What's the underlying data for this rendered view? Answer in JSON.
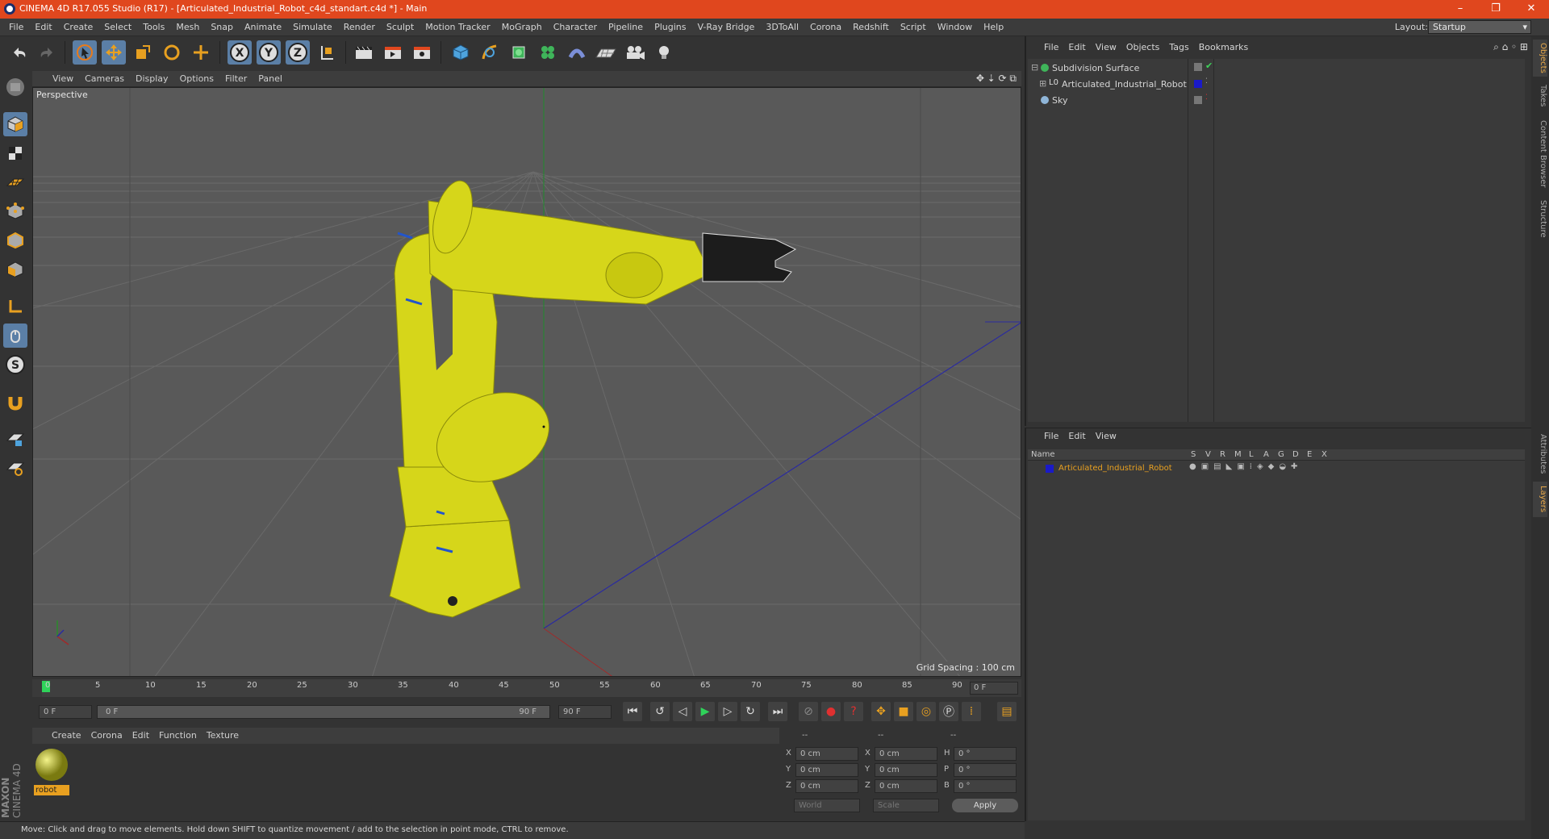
{
  "window": {
    "title": "CINEMA 4D R17.055 Studio (R17) - [Articulated_Industrial_Robot_c4d_standart.c4d *] - Main",
    "minimize": "–",
    "maximize": "❐",
    "close": "✕"
  },
  "menubar": {
    "items": [
      "File",
      "Edit",
      "Create",
      "Select",
      "Tools",
      "Mesh",
      "Snap",
      "Animate",
      "Simulate",
      "Render",
      "Sculpt",
      "Motion Tracker",
      "MoGraph",
      "Character",
      "Pipeline",
      "Plugins",
      "V-Ray Bridge",
      "3DToAll",
      "Corona",
      "Redshift",
      "Script",
      "Window",
      "Help"
    ],
    "layout_label": "Layout:",
    "layout_value": "Startup"
  },
  "viewport": {
    "menu": [
      "View",
      "Cameras",
      "Display",
      "Options",
      "Filter",
      "Panel"
    ],
    "label": "Perspective",
    "grid_spacing": "Grid Spacing : 100 cm"
  },
  "timeline": {
    "ticks": [
      "0",
      "5",
      "10",
      "15",
      "20",
      "25",
      "30",
      "35",
      "40",
      "45",
      "50",
      "55",
      "60",
      "65",
      "70",
      "75",
      "80",
      "85",
      "90"
    ],
    "end_field": "0 F"
  },
  "transport": {
    "start": "0 F",
    "range_start": "0 F",
    "range_end": "90 F",
    "end": "90 F"
  },
  "materials": {
    "menu": [
      "Create",
      "Corona",
      "Edit",
      "Function",
      "Texture"
    ],
    "items": [
      {
        "name": "robot"
      }
    ]
  },
  "coords": {
    "headers": [
      "--",
      "--",
      "--"
    ],
    "rows": [
      {
        "a": "X",
        "av": "0 cm",
        "b": "X",
        "bv": "0 cm",
        "c": "H",
        "cv": "0 °"
      },
      {
        "a": "Y",
        "av": "0 cm",
        "b": "Y",
        "bv": "0 cm",
        "c": "P",
        "cv": "0 °"
      },
      {
        "a": "Z",
        "av": "0 cm",
        "b": "Z",
        "bv": "0 cm",
        "c": "B",
        "cv": "0 °"
      }
    ],
    "world": "World",
    "scale": "Scale",
    "apply": "Apply"
  },
  "status": "Move: Click and drag to move elements. Hold down SHIFT to quantize movement / add to the selection in point mode, CTRL to remove.",
  "objects": {
    "menu": [
      "File",
      "Edit",
      "View",
      "Objects",
      "Tags",
      "Bookmarks"
    ],
    "items": [
      {
        "name": "Subdivision Surface"
      },
      {
        "name": "Articulated_Industrial_Robot"
      },
      {
        "name": "Sky"
      }
    ]
  },
  "layers": {
    "menu": [
      "File",
      "Edit",
      "View"
    ],
    "header_name": "Name",
    "cols": [
      "S",
      "V",
      "R",
      "M",
      "L",
      "A",
      "G",
      "D",
      "E",
      "X"
    ],
    "items": [
      {
        "name": "Articulated_Industrial_Robot"
      }
    ]
  },
  "right_tabs": [
    "Objects",
    "Takes",
    "Content Browser",
    "Structure",
    "Attributes",
    "Layers"
  ],
  "brand": {
    "line1": "MAXON",
    "line2": "CINEMA 4D"
  }
}
